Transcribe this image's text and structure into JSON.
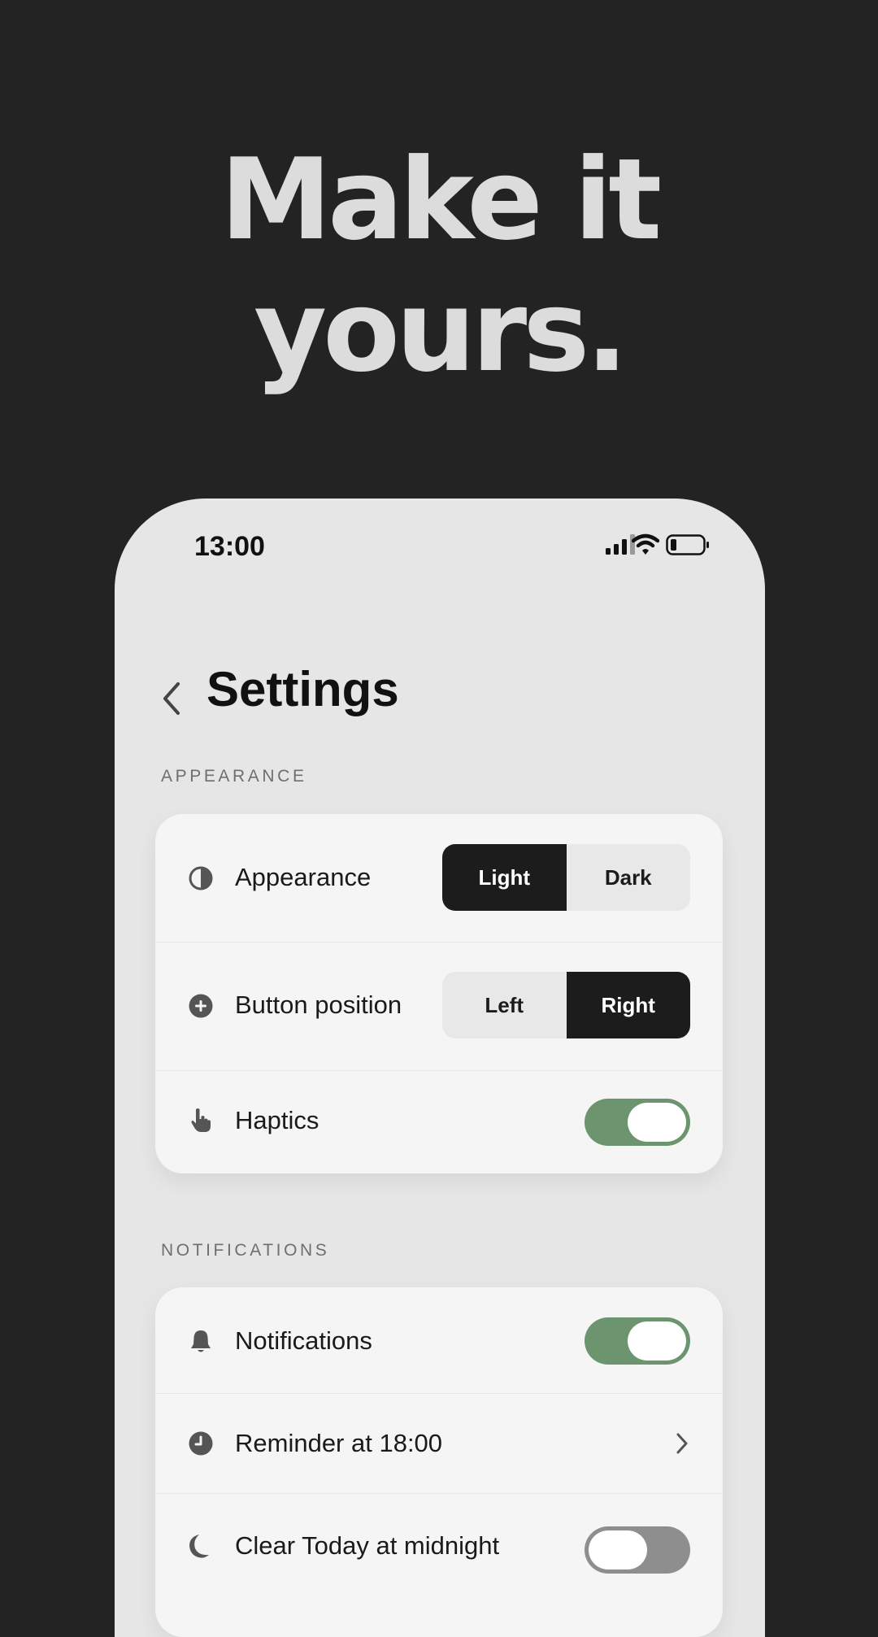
{
  "headline": {
    "line1": "Make it",
    "line2": "yours."
  },
  "status_bar": {
    "time": "13:00",
    "icons": [
      "cellular-signal-icon",
      "wifi-icon",
      "battery-icon"
    ]
  },
  "header": {
    "back_icon": "chevron-left-icon",
    "title": "Settings"
  },
  "appearance_section": {
    "label": "APPEARANCE",
    "rows": {
      "appearance": {
        "icon": "half-circle-icon",
        "label": "Appearance",
        "options": [
          "Light",
          "Dark"
        ],
        "selected": "Light"
      },
      "button_position": {
        "icon": "plus-circle-icon",
        "label": "Button position",
        "options": [
          "Left",
          "Right"
        ],
        "selected": "Right"
      },
      "haptics": {
        "icon": "hand-pointer-icon",
        "label": "Haptics",
        "enabled": true
      }
    }
  },
  "notifications_section": {
    "label": "NOTIFICATIONS",
    "rows": {
      "notifications": {
        "icon": "bell-icon",
        "label": "Notifications",
        "enabled": true
      },
      "reminder": {
        "icon": "clock-icon",
        "label": "Reminder at 18:00",
        "trailing_icon": "chevron-right-icon"
      },
      "clear_today": {
        "icon": "moon-icon",
        "label": "Clear Today at midnight",
        "enabled": false
      }
    }
  },
  "colors": {
    "page_background": "#232323",
    "headline": "#dcdcdc",
    "screen_background": "#e6e6e6",
    "card_background": "#f5f5f5",
    "segment_active": "#1c1c1c",
    "toggle_on": "#6b946f",
    "toggle_off": "#8e8e8e"
  }
}
